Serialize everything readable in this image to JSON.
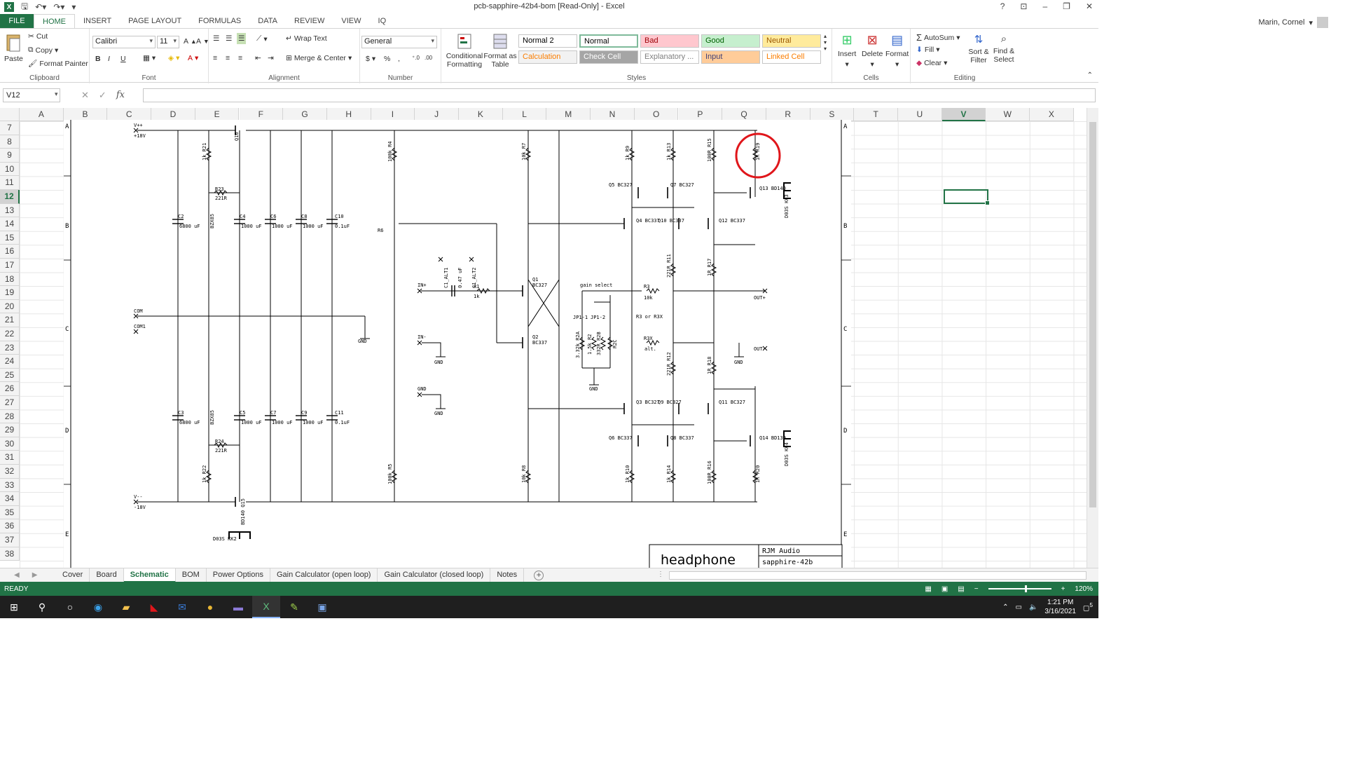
{
  "titlebar": {
    "title": "pcb-sapphire-42b4-bom  [Read-Only] - Excel",
    "help": "?",
    "minimize": "–",
    "restore": "❐",
    "close": "✕"
  },
  "ribbon_tabs": [
    "FILE",
    "HOME",
    "INSERT",
    "PAGE LAYOUT",
    "FORMULAS",
    "DATA",
    "REVIEW",
    "VIEW",
    "IQ"
  ],
  "user": "Marin, Cornel",
  "clipboard": {
    "paste": "Paste",
    "cut": "Cut",
    "copy": "Copy",
    "format_painter": "Format Painter",
    "label": "Clipboard"
  },
  "font": {
    "name": "Calibri",
    "size": "11",
    "label": "Font",
    "bold": "B",
    "italic": "I",
    "underline": "U"
  },
  "alignment": {
    "wrap_text": "Wrap Text",
    "merge_center": "Merge & Center",
    "label": "Alignment"
  },
  "number": {
    "format": "General",
    "label": "Number",
    "currency": "$",
    "percent": "%",
    "comma": ","
  },
  "styles": {
    "conditional": "Conditional Formatting",
    "format_table": "Format as Table",
    "cells": [
      {
        "label": "Normal 2",
        "bg": "#ffffff",
        "fg": "#000000"
      },
      {
        "label": "Normal",
        "bg": "#ffffff",
        "fg": "#000000"
      },
      {
        "label": "Bad",
        "bg": "#ffc7ce",
        "fg": "#9c0006"
      },
      {
        "label": "Good",
        "bg": "#c6efce",
        "fg": "#006100"
      },
      {
        "label": "Neutral",
        "bg": "#ffeb9c",
        "fg": "#9c5700"
      },
      {
        "label": "Calculation",
        "bg": "#f2f2f2",
        "fg": "#fa7d00"
      },
      {
        "label": "Check Cell",
        "bg": "#a5a5a5",
        "fg": "#ffffff"
      },
      {
        "label": "Explanatory ...",
        "bg": "#ffffff",
        "fg": "#7f7f7f"
      },
      {
        "label": "Input",
        "bg": "#ffcc99",
        "fg": "#3f3f76"
      },
      {
        "label": "Linked Cell",
        "bg": "#ffffff",
        "fg": "#fa7d00"
      }
    ],
    "label": "Styles"
  },
  "cells_group": {
    "insert": "Insert",
    "delete": "Delete",
    "format": "Format",
    "label": "Cells"
  },
  "editing": {
    "autosum": "AutoSum",
    "fill": "Fill",
    "clear": "Clear",
    "sort_filter": "Sort & Filter",
    "find_select": "Find & Select",
    "label": "Editing"
  },
  "formula_bar": {
    "name_box": "V12",
    "fx": "fx",
    "value": ""
  },
  "columns": [
    "A",
    "B",
    "C",
    "D",
    "E",
    "F",
    "G",
    "H",
    "I",
    "J",
    "K",
    "L",
    "M",
    "N",
    "O",
    "P",
    "Q",
    "R",
    "S",
    "T",
    "U",
    "V",
    "W",
    "X"
  ],
  "rows": [
    "7",
    "8",
    "9",
    "10",
    "11",
    "12",
    "13",
    "14",
    "15",
    "16",
    "17",
    "18",
    "19",
    "20",
    "21",
    "22",
    "23",
    "24",
    "25",
    "26",
    "27",
    "28",
    "29",
    "30",
    "31",
    "32",
    "33",
    "34",
    "35",
    "36",
    "37",
    "38"
  ],
  "selected_cell": "V12",
  "schematic": {
    "zone_left": [
      "A",
      "B",
      "C",
      "D",
      "E"
    ],
    "title_block": {
      "name": "headphone",
      "company": "RJM Audio",
      "project": "sapphire-42b"
    },
    "labels": {
      "vpos": "V++",
      "vpos_val": "+18V",
      "vneg": "V--",
      "vneg_val": "-18V",
      "com": "COM",
      "com1": "COM1",
      "gnd": "GND",
      "in_pos": "IN+",
      "in_neg": "IN-",
      "out_pos": "OUT+",
      "out_neg": "OUT-",
      "gain_select": "gain select",
      "r3_note": "R3 or R3X",
      "alt": "alt.",
      "r21": "1k R21",
      "r22": "1k R22",
      "r23": "R23",
      "r23v": "221R",
      "r24": "R24",
      "r24v": "221R",
      "c2": "C2",
      "c2v": "6800 uF",
      "c3": "C3",
      "c3v": "6800 uF",
      "c4": "C4",
      "c5": "C5",
      "c6": "C6",
      "c7": "C7",
      "c8": "C8",
      "c9": "C9",
      "c1000": "1000 uF",
      "c10": "C10",
      "c11": "C11",
      "c01": "0.1uF",
      "led": "BZX85",
      "q16": "Q16",
      "q15": "BD140 Q15",
      "kk2": "D03S KK2",
      "r4": "100k R4",
      "r5": "100k R5",
      "r6": "R6",
      "r7": "10k R7",
      "r8": "10k R8",
      "c1alt1": "C1_ALT1",
      "c1alt2": "C1_ALT2",
      "c047": "0.47 uF",
      "r1": "R1",
      "r1v": "1k",
      "q1": "Q1",
      "q1v": "BC327",
      "q2": "Q2",
      "q2v": "BC337",
      "r9": "1k R9",
      "r13": "1k R13",
      "r10": "1k R10",
      "r14": "1k R14",
      "r15": "100R R15",
      "r16": "100R R16",
      "r19": "1R R19",
      "r20": "1R R20",
      "r11": "221R R11",
      "r12": "221R R12",
      "r17": "1R R17",
      "r18": "1R R18",
      "r3": "R3",
      "r3v": "10k",
      "r3x": "R3X",
      "q5": "Q5 BC327",
      "q7": "Q7 BC327",
      "q4": "Q4 BC337",
      "q10": "Q10 BC337",
      "q12": "Q12 BC337",
      "q13": "Q13 BD140",
      "kk3": "D03S KK3",
      "q3": "Q3 BC327",
      "q9": "Q9 BC327",
      "q11": "Q11 BC327",
      "q6": "Q6 BC337",
      "q8": "Q8 BC337",
      "q14": "Q14 BD139",
      "kk4": "D03S KK4",
      "jp11": "JP1-1",
      "jp12": "JP1-2",
      "r2a": "3.32k R2A",
      "r2": "1.5k R2",
      "r2b": "332R R2B",
      "r2c": "R2C"
    }
  },
  "sheets": [
    "Cover",
    "Board",
    "Schematic",
    "BOM",
    "Power Options",
    "Gain Calculator (open loop)",
    "Gain Calculator (closed loop)",
    "Notes"
  ],
  "active_sheet": "Schematic",
  "status": {
    "ready": "READY",
    "zoom": "120%"
  },
  "taskbar": {
    "time": "1:21 PM",
    "date": "3/16/2021",
    "notif": "5"
  },
  "colors": {
    "excel_green": "#217346",
    "highlight_circle": "#e0161b"
  }
}
